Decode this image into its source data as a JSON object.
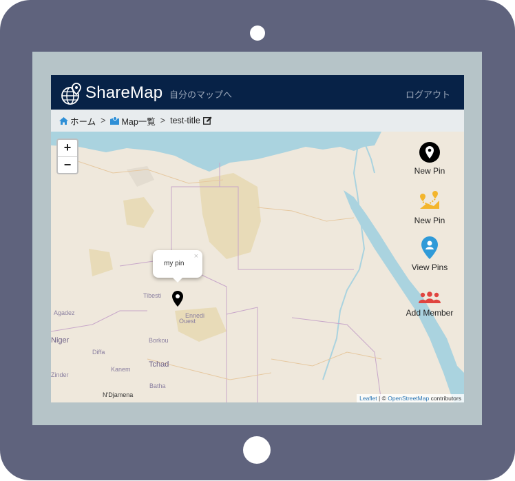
{
  "navbar": {
    "brand": "ShareMap",
    "my_maps_link": "自分のマップへ",
    "logout": "ログアウト"
  },
  "breadcrumb": {
    "home": "ホーム",
    "separator": ">",
    "map_list": "Map一覧",
    "current": "test-title"
  },
  "map": {
    "zoom_in": "+",
    "zoom_out": "−",
    "popup_text": "my pin",
    "popup_close": "×",
    "attribution_leaflet": "Leaflet",
    "attribution_sep": " | © ",
    "attribution_osm": "OpenStreetMap",
    "attribution_contrib": " contributors",
    "labels": {
      "tibesti": "Tibesti",
      "ennedi": "Ennedi",
      "ouest": "Ouest",
      "agadez": "Agadez",
      "niger": "Niger",
      "borkou": "Borkou",
      "tchad": "Tchad",
      "batha": "Batha",
      "kanem": "Kanem",
      "zinder": "Zinder",
      "diffa": "Diffa",
      "ndjamena": "N'Djamena"
    }
  },
  "tools": [
    {
      "label": "New Pin",
      "icon": "map-marker-black-icon"
    },
    {
      "label": "New Pin",
      "icon": "route-yellow-icon"
    },
    {
      "label": "View Pins",
      "icon": "map-marker-blue-icon"
    },
    {
      "label": "Add Member",
      "icon": "users-red-icon"
    }
  ],
  "colors": {
    "navbar": "#072247",
    "tablet_frame": "#5f637d",
    "water": "#aad3df",
    "land": "#efe8dc",
    "link": "#2a76b4"
  }
}
